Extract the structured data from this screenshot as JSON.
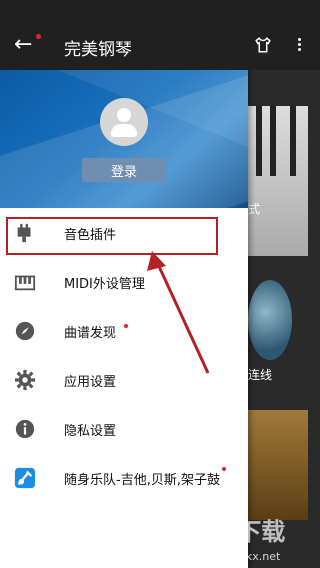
{
  "appbar": {
    "title": "完美钢琴"
  },
  "header": {
    "login_label": "登录"
  },
  "menu": [
    {
      "label": "音色插件",
      "icon": "plugin-icon"
    },
    {
      "label": "MIDI外设管理",
      "icon": "midi-icon"
    },
    {
      "label": "曲谱发现",
      "icon": "compass-icon"
    },
    {
      "label": "应用设置",
      "icon": "gear-icon"
    },
    {
      "label": "隐私设置",
      "icon": "info-icon"
    },
    {
      "label": "随身乐队-吉他,贝斯,架子鼓",
      "icon": "band-app-icon"
    }
  ],
  "background": {
    "label1": "式",
    "label2": "连线"
  },
  "watermark": {
    "logo": "KK下载",
    "url": "www.kkx.net"
  },
  "colors": {
    "accent": "#1a72bd",
    "badge": "#e0232b",
    "annotation": "#b22222"
  }
}
